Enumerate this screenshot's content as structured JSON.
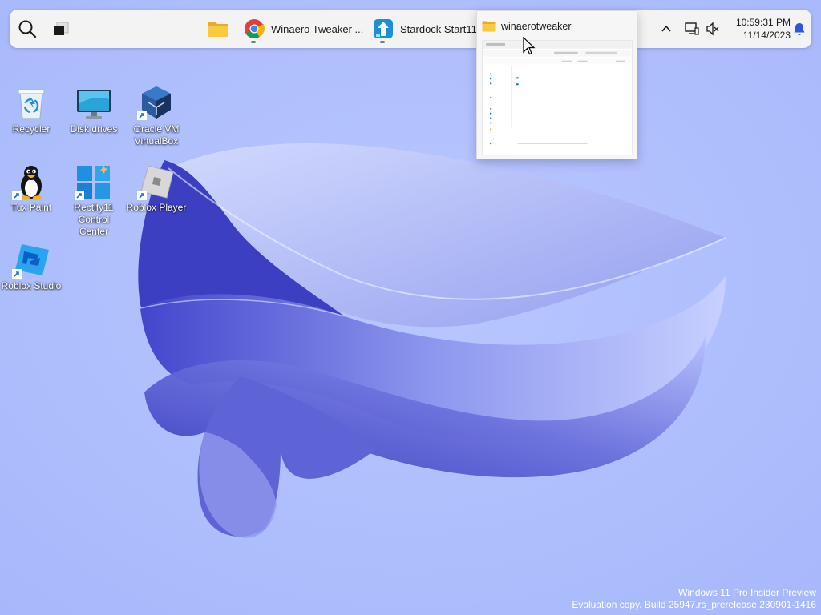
{
  "taskbar": {
    "apps": [
      {
        "name": "File Explorer",
        "label": "",
        "icon": "folder-icon"
      },
      {
        "name": "Google Chrome",
        "label": "Winaero Tweaker ...",
        "icon": "chrome-icon"
      },
      {
        "name": "Stardock Start11",
        "label": "Stardock Start11 ...",
        "icon": "start11-icon"
      }
    ],
    "clock": {
      "time": "10:59:31 PM",
      "date": "11/14/2023"
    }
  },
  "preview": {
    "title": "winaerotweaker",
    "icon": "folder-icon"
  },
  "desktop": {
    "icons": [
      {
        "id": "recycler",
        "label": "Recycler",
        "icon": "recycle-bin-icon"
      },
      {
        "id": "disk-drives",
        "label": "Disk drives",
        "icon": "monitor-icon"
      },
      {
        "id": "virtualbox",
        "label": "Oracle VM\nVirtualBox",
        "icon": "virtualbox-icon"
      },
      {
        "id": "tux-paint",
        "label": "Tux Paint",
        "icon": "tux-penguin-icon"
      },
      {
        "id": "rectify11",
        "label": "Rectify11\nControl\nCenter",
        "icon": "windows-logo-icon"
      },
      {
        "id": "roblox-player",
        "label": "Roblox Player",
        "icon": "roblox-icon"
      },
      {
        "id": "roblox-studio",
        "label": "Roblox Studio",
        "icon": "roblox-studio-icon"
      }
    ]
  },
  "watermark": {
    "line1": "Windows 11 Pro Insider Preview",
    "line2": "Evaluation copy. Build 25947.rs_prerelease.230901-1416"
  },
  "colors": {
    "desktop_bg": "#a8bafc",
    "taskbar_bg": "#f3f3f3",
    "bloom_dark": "#3d3fc2"
  }
}
